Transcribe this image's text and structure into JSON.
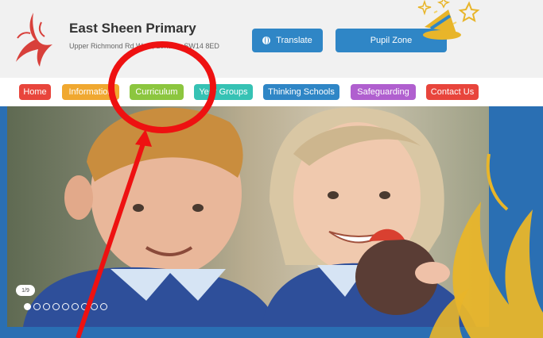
{
  "header": {
    "school_name": "East Sheen Primary",
    "school_address": "Upper Richmond Rd West, London, SW14 8ED",
    "translate_label": "Translate",
    "pupil_zone_label": "Pupil Zone"
  },
  "nav": {
    "items": [
      {
        "label": "Home",
        "color": "#e8453c"
      },
      {
        "label": "Information",
        "color": "#f0a830"
      },
      {
        "label": "Curriculum",
        "color": "#8cc63f"
      },
      {
        "label": "Year Groups",
        "color": "#36c2b4"
      },
      {
        "label": "Thinking Schools",
        "color": "#2f86c6"
      },
      {
        "label": "Safeguarding",
        "color": "#b05fcf"
      },
      {
        "label": "Contact Us",
        "color": "#e8453c"
      }
    ]
  },
  "slider": {
    "counter": "1/9",
    "slide_count": 9,
    "active_index": 0
  },
  "colors": {
    "button_blue": "#2f86c6",
    "hero_blue": "#2a6fb3",
    "annotation_red": "#ee1111",
    "flame_gold": "#e8b52a"
  }
}
